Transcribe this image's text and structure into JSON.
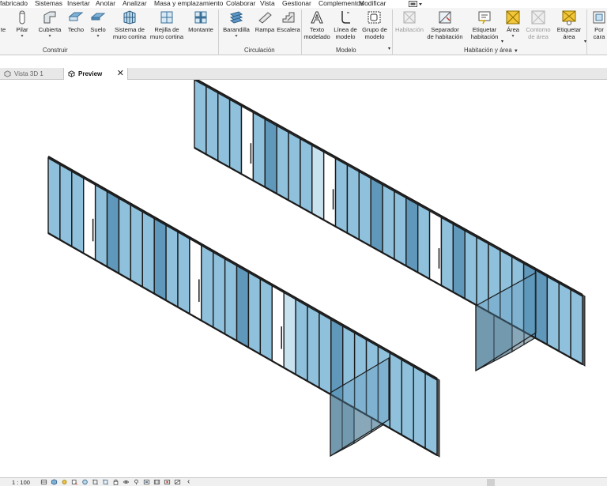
{
  "menubar": {
    "items": [
      "fabricado",
      "Sistemas",
      "Insertar",
      "Anotar",
      "Analizar",
      "Masa y emplazamiento",
      "Colaborar",
      "Vista",
      "Gestionar",
      "Complementos",
      "Modificar"
    ]
  },
  "ribbon": {
    "construir": {
      "label": "Construir",
      "tools": [
        {
          "l1": "te",
          "l2": "",
          "icon": "partial-tool-icon"
        },
        {
          "l1": "Pilar",
          "l2": "",
          "icon": "column-icon"
        },
        {
          "l1": "Cubierta",
          "l2": "",
          "icon": "roof-icon"
        },
        {
          "l1": "Techo",
          "l2": "",
          "icon": "ceiling-icon"
        },
        {
          "l1": "Suelo",
          "l2": "",
          "icon": "floor-icon"
        },
        {
          "l1": "Sistema de",
          "l2": "muro cortina",
          "icon": "curtain-system-icon"
        },
        {
          "l1": "Rejilla de",
          "l2": "muro cortina",
          "icon": "curtain-grid-icon"
        },
        {
          "l1": "Montante",
          "l2": "",
          "icon": "mullion-icon"
        }
      ]
    },
    "circulacion": {
      "label": "Circulación",
      "tools": [
        {
          "l1": "Barandilla",
          "l2": "",
          "icon": "railing-icon"
        },
        {
          "l1": "Rampa",
          "l2": "",
          "icon": "ramp-icon"
        },
        {
          "l1": "Escalera",
          "l2": "",
          "icon": "stair-icon"
        }
      ]
    },
    "modelo": {
      "label": "Modelo",
      "tools": [
        {
          "l1": "Texto",
          "l2": "modelado",
          "icon": "model-text-icon"
        },
        {
          "l1": "Línea de",
          "l2": "modelo",
          "icon": "model-line-icon"
        },
        {
          "l1": "Grupo de",
          "l2": "modelo",
          "icon": "model-group-icon"
        }
      ]
    },
    "habitacion": {
      "label": "Habitación y área",
      "tools": [
        {
          "l1": "Habitación",
          "l2": "",
          "icon": "room-icon"
        },
        {
          "l1": "Separador",
          "l2": "de habitación",
          "icon": "room-separator-icon"
        },
        {
          "l1": "Etiquetar",
          "l2": "habitación",
          "icon": "tag-room-icon"
        },
        {
          "l1": "Área",
          "l2": "",
          "icon": "area-icon"
        },
        {
          "l1": "Contorno",
          "l2": "de área",
          "icon": "area-boundary-icon"
        },
        {
          "l1": "Etiquetar",
          "l2": "área",
          "icon": "tag-area-icon"
        },
        {
          "l1": "Por",
          "l2": "cara",
          "icon": "by-face-icon"
        }
      ]
    }
  },
  "tabs": [
    {
      "label": "Vista 3D 1",
      "active": false
    },
    {
      "label": "Preview",
      "active": true,
      "close": "✕"
    }
  ],
  "status": {
    "scale": "1 : 100",
    "scroll_left": "‹"
  },
  "colors": {
    "glass": "#8fc1dc",
    "glass_dark": "#5f98bb",
    "glass_light": "#c9e2ef",
    "frame": "#1a1a1a",
    "ribbon_bg": "#f5f5f5"
  }
}
